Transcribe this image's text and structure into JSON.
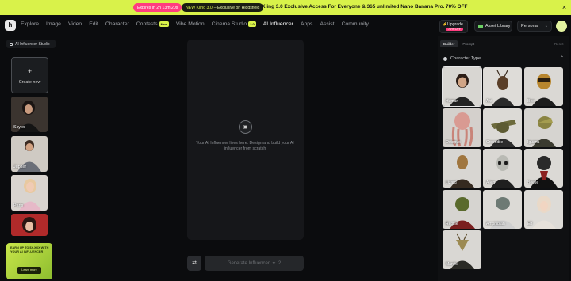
{
  "banner": {
    "timer": "Expires in 2h 13m 20s",
    "kling_badge": "NEW Kling 3.0",
    "kling_suffix": "– Exclusive on Higgsfield",
    "message": "Kling 3.0 Exclusive Access For Everyone & 365 unlimited Nano Banana Pro. 70% OFF",
    "close": "×"
  },
  "nav": {
    "logo": "h",
    "items": [
      {
        "label": "Explore"
      },
      {
        "label": "Image"
      },
      {
        "label": "Video"
      },
      {
        "label": "Edit"
      },
      {
        "label": "Character"
      },
      {
        "label": "Contests",
        "tag": "New"
      },
      {
        "label": "Vibe Motion"
      },
      {
        "label": "Cinema Studio",
        "tag": "2.0"
      },
      {
        "label": "AI Influencer"
      },
      {
        "label": "Apps"
      },
      {
        "label": "Assist"
      },
      {
        "label": "Community"
      }
    ],
    "upgrade_label": "Upgrade",
    "upgrade_badge": "70% OFF",
    "asset_library": "Asset Library",
    "workspace": "Personal"
  },
  "sidebar": {
    "studio_label": "AI Influencer Studio",
    "create_label": "Create new",
    "personas": [
      {
        "name": "Skyler"
      },
      {
        "name": "Jupiter"
      },
      {
        "name": "Paris"
      },
      {
        "name": ""
      }
    ],
    "promo_text": "EARN UP TO $X,XXX WITH YOUR AI INFLUENCER",
    "promo_button": "Learn more"
  },
  "center": {
    "empty_text": "Your AI Influencer lives here. Design and build your AI influencer from scratch",
    "generate_label": "Generate Influencer",
    "generate_cost": "2"
  },
  "builder": {
    "tabs": [
      "Builder",
      "Prompt"
    ],
    "active_tab": "Builder",
    "reset": "Reset",
    "section_title": "Character Type",
    "types": [
      {
        "label": "Human",
        "selected": true
      },
      {
        "label": "Ant"
      },
      {
        "label": "Bee"
      },
      {
        "label": "Octopus"
      },
      {
        "label": "Crocodile"
      },
      {
        "label": "Iguana"
      },
      {
        "label": "Lizard"
      },
      {
        "label": "Alien"
      },
      {
        "label": "Beetle"
      },
      {
        "label": "Reptile"
      },
      {
        "label": "Amphibian"
      },
      {
        "label": "Elf"
      },
      {
        "label": "Mantis"
      }
    ]
  },
  "colors": {
    "accent": "#d9f24a",
    "timer_pink": "#ff3d7f"
  }
}
